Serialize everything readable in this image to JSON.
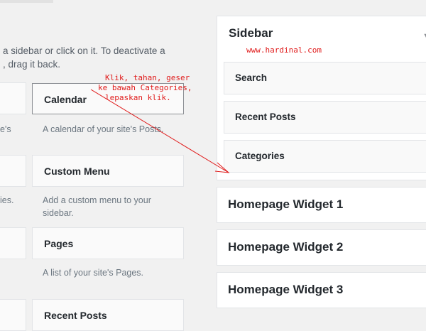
{
  "available_widgets": {
    "description_line1": "a sidebar or click on it. To deactivate a",
    "description_line2": ", drag it back.",
    "left_column": [
      {
        "desc": "e's"
      },
      {
        "desc": "ies."
      },
      {
        "desc": ""
      },
      {
        "desc": ""
      }
    ],
    "right_column": [
      {
        "title": "Calendar",
        "desc_lines": [
          "A calendar of your site's Posts."
        ]
      },
      {
        "title": "Custom Menu",
        "desc_lines": [
          "Add a custom menu to your",
          "sidebar."
        ]
      },
      {
        "title": "Pages",
        "desc_lines": [
          "A list of your site's Pages."
        ]
      },
      {
        "title": "Recent Posts",
        "desc_lines": []
      }
    ]
  },
  "sidebar": {
    "title": "Sidebar",
    "watermark": "www.hardinal.com",
    "widgets": [
      {
        "title": "Search"
      },
      {
        "title": "Recent Posts"
      },
      {
        "title": "Categories"
      }
    ]
  },
  "homepage_areas": [
    {
      "title": "Homepage Widget 1"
    },
    {
      "title": "Homepage Widget 2"
    },
    {
      "title": "Homepage Widget 3"
    }
  ],
  "annotation": {
    "lines": [
      "Klik, tahan, geser",
      "ke bawah Categories,",
      "lepaskan klik."
    ],
    "color": "#e01b1b"
  },
  "icons": {
    "collapse_arrow": "triangle-down-icon"
  }
}
